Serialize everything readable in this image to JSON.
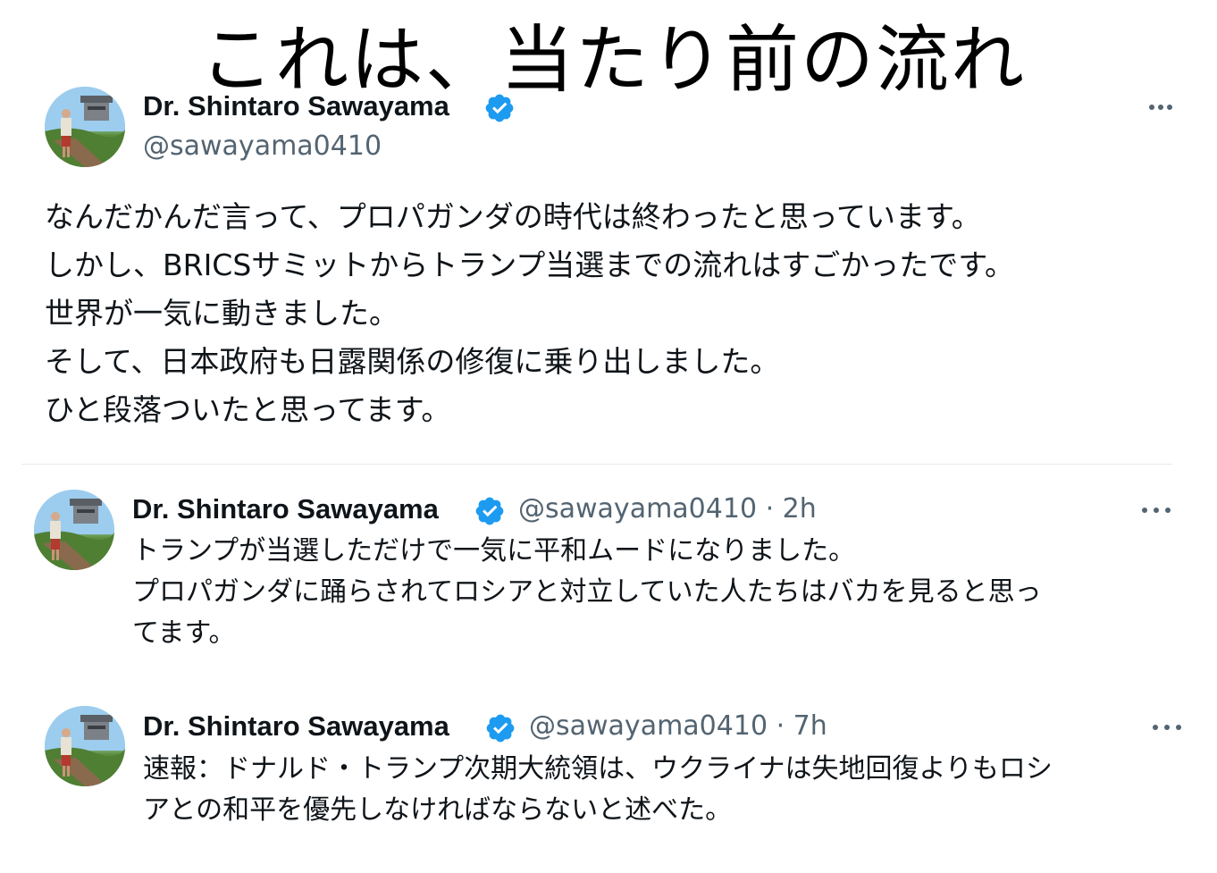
{
  "overlay_title": "これは、当たり前の流れ",
  "colors": {
    "verified": "#1d9bf0",
    "secondary_text": "#536471",
    "primary_text": "#0f1419"
  },
  "main_tweet": {
    "name": "Dr. Shintaro Sawayama",
    "handle": "@sawayama0410",
    "avatar_icon": "profile-photo-icon",
    "verified_icon": "verified-badge-icon",
    "more_icon": "more-horizontal-icon",
    "lines": [
      "なんだかんだ言って、プロパガンダの時代は終わったと思っています。",
      "しかし、BRICSサミットからトランプ当選までの流れはすごかったです。",
      "世界が一気に動きました。",
      "そして、日本政府も日露関係の修復に乗り出しました。",
      "ひと段落ついたと思ってます。"
    ]
  },
  "quoted_tweets": [
    {
      "name": "Dr. Shintaro Sawayama",
      "handle_time": "@sawayama0410 · 2h",
      "lines": [
        "トランプが当選しただけで一気に平和ムードになりました。",
        "プロパガンダに踊らされてロシアと対立していた人たちはバカを見ると思っ",
        "てます。"
      ]
    },
    {
      "name": "Dr. Shintaro Sawayama",
      "handle_time": "@sawayama0410 · 7h",
      "lines": [
        "速報：ドナルド・トランプ次期大統領は、ウクライナは失地回復よりもロシ",
        "アとの和平を優先しなければならないと述べた。"
      ]
    }
  ]
}
